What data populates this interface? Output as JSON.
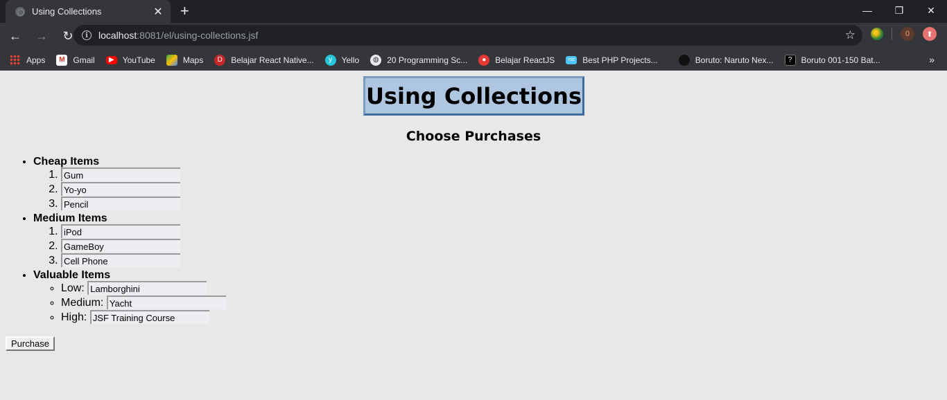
{
  "browser": {
    "tab_title": "Using Collections",
    "tab_close": "✕",
    "new_tab": "+",
    "window_controls": {
      "minimize": "—",
      "maximize": "❐",
      "close": "✕"
    },
    "nav": {
      "back": "←",
      "forward": "→",
      "reload": "↻"
    },
    "url_host": "localhost",
    "url_path": ":8081/el/using-collections.jsf",
    "star": "☆",
    "ext_badge": "0",
    "bookmarks": [
      {
        "label": "Apps",
        "icon": "apps-icon"
      },
      {
        "label": "Gmail",
        "icon": "gmail-icon"
      },
      {
        "label": "YouTube",
        "icon": "youtube-icon"
      },
      {
        "label": "Maps",
        "icon": "maps-icon"
      },
      {
        "label": "Belajar React Native...",
        "icon": "belajar-react-native-icon"
      },
      {
        "label": "Yello",
        "icon": "yello-icon"
      },
      {
        "label": "20 Programming Sc...",
        "icon": "globe-icon"
      },
      {
        "label": "Belajar ReactJS",
        "icon": "reactjs-icon"
      },
      {
        "label": "Best PHP Projects...",
        "icon": "php-icon"
      },
      {
        "label": "Boruto: Naruto Nex...",
        "icon": "boruto-icon"
      },
      {
        "label": "Boruto 001-150 Bat...",
        "icon": "book-icon"
      }
    ],
    "bookmarks_more": "»"
  },
  "page": {
    "title": "Using Collections",
    "subtitle": "Choose Purchases",
    "cheap": {
      "label": "Cheap Items",
      "items": [
        "Gum",
        "Yo-yo",
        "Pencil"
      ]
    },
    "medium": {
      "label": "Medium Items",
      "items": [
        "iPod",
        "GameBoy",
        "Cell Phone"
      ]
    },
    "valuable": {
      "label": "Valuable Items",
      "low_label": "Low:",
      "low_value": "Lamborghini",
      "medium_label": "Medium:",
      "medium_value": "Yacht",
      "high_label": "High:",
      "high_value": "JSF Training Course"
    },
    "purchase_label": "Purchase"
  }
}
